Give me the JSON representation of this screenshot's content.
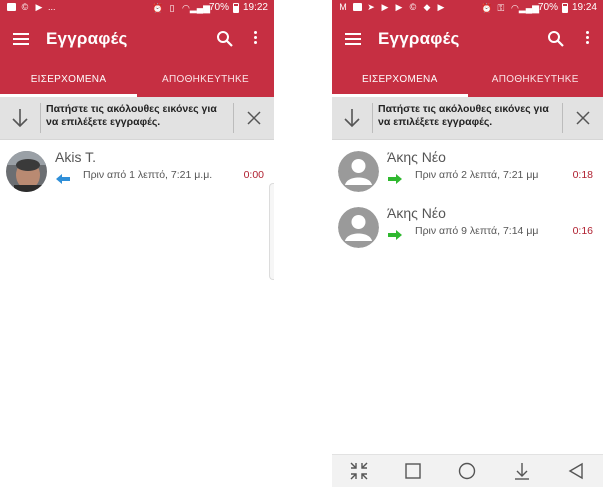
{
  "colors": {
    "primary": "#c62f42",
    "incoming_arrow": "#2f8fd8",
    "outgoing_arrow": "#2fb82f",
    "duration": "#b02030"
  },
  "left": {
    "status": {
      "battery": "70%",
      "time": "19:22",
      "overflow": "..."
    },
    "app": {
      "title": "Εγγραφές",
      "search_icon": "search-icon",
      "more_icon": "more-vert-icon"
    },
    "tabs": [
      {
        "label": "ΕΙΣΕΡΧΟΜΕΝΑ",
        "active": true
      },
      {
        "label": "ΑΠΟΘΗΚΕΥΤΗΚΕ",
        "active": false
      }
    ],
    "hint": {
      "text": "Πατήστε τις ακόλουθες εικόνες για να επιλέξετε εγγραφές."
    },
    "records": [
      {
        "name": "Akis T.",
        "direction": "incoming",
        "time": "Πριν από 1 λεπτό, 7:21 μ.μ.",
        "duration": "0:00",
        "avatar": "photo"
      }
    ]
  },
  "right": {
    "status": {
      "battery": "70%",
      "time": "19:24"
    },
    "app": {
      "title": "Εγγραφές",
      "search_icon": "search-icon",
      "more_icon": "more-vert-icon"
    },
    "tabs": [
      {
        "label": "ΕΙΣΕΡΧΟΜΕΝΑ",
        "active": true
      },
      {
        "label": "ΑΠΟΘΗΚΕΥΤΗΚΕ",
        "active": false
      }
    ],
    "hint": {
      "text": "Πατήστε τις ακόλουθες εικόνες για να επιλέξετε εγγραφές."
    },
    "records": [
      {
        "name": "Άκης Νέο",
        "direction": "outgoing",
        "time": "Πριν από 2 λεπτά, 7:21 μμ",
        "duration": "0:18",
        "avatar": "default"
      },
      {
        "name": "Άκης Νέο",
        "direction": "outgoing",
        "time": "Πριν από 9 λεπτά, 7:14 μμ",
        "duration": "0:16",
        "avatar": "default"
      }
    ],
    "navbar": [
      "collapse-icon",
      "recents-icon",
      "home-icon",
      "download-icon",
      "back-icon"
    ]
  }
}
